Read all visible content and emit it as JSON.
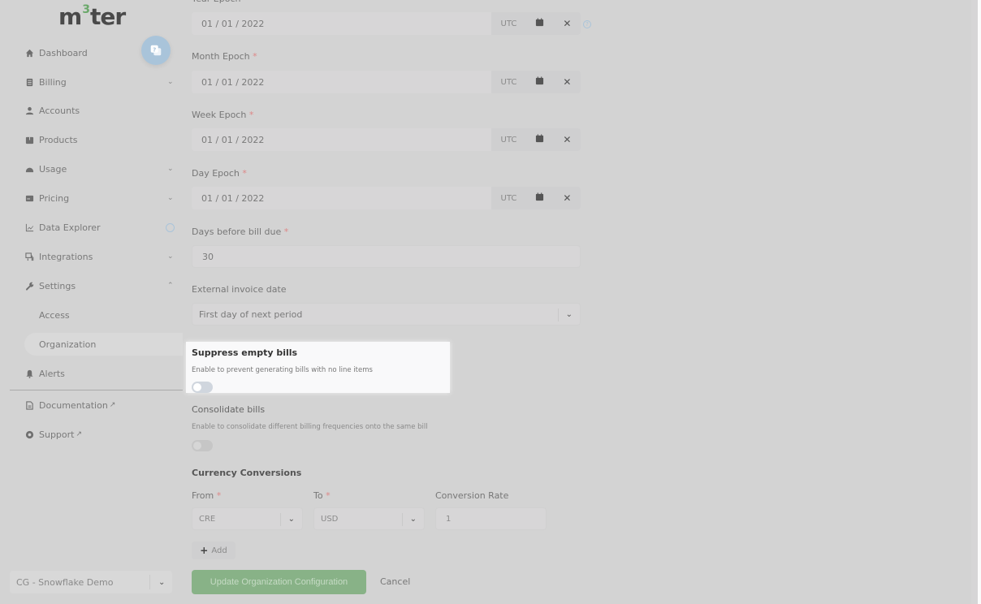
{
  "brand": {
    "logo_pre": "m",
    "logo_sup": "3",
    "logo_post": "ter",
    "accent": "#6aa86a"
  },
  "sidebar": {
    "items": [
      {
        "label": "Dashboard",
        "icon": "home-icon"
      },
      {
        "label": "Billing",
        "icon": "billing-icon",
        "expand": "⌄"
      },
      {
        "label": "Accounts",
        "icon": "user-icon"
      },
      {
        "label": "Products",
        "icon": "box-icon"
      },
      {
        "label": "Usage",
        "icon": "gauge-icon",
        "expand": "⌄"
      },
      {
        "label": "Pricing",
        "icon": "pricing-icon",
        "expand": "⌄"
      },
      {
        "label": "Data Explorer",
        "icon": "chart-icon"
      },
      {
        "label": "Integrations",
        "icon": "integrations-icon",
        "expand": "⌄"
      },
      {
        "label": "Settings",
        "icon": "wrench-icon",
        "expand": "⌃"
      },
      {
        "label": "Alerts",
        "icon": "bell-icon"
      },
      {
        "label": "Documentation",
        "icon": "document-icon"
      },
      {
        "label": "Support",
        "icon": "lifebuoy-icon"
      }
    ],
    "settings_sub": [
      "Access",
      "Organization"
    ],
    "active_sub": "Organization",
    "org_select": "CG - Snowflake Demo",
    "chevron": "⌄"
  },
  "form": {
    "year_epoch": {
      "label": "Year Epoch",
      "value": "01 / 01 / 2022",
      "tz": "UTC"
    },
    "month_epoch": {
      "label": "Month Epoch",
      "value": "01 / 01 / 2022",
      "tz": "UTC"
    },
    "week_epoch": {
      "label": "Week Epoch",
      "value": "01 / 01 / 2022",
      "tz": "UTC"
    },
    "day_epoch": {
      "label": "Day Epoch",
      "value": "01 / 01 / 2022",
      "tz": "UTC"
    },
    "required_mark": "*",
    "days_before_due": {
      "label": "Days before bill due",
      "value": "30"
    },
    "external_invoice_date": {
      "label": "External invoice date",
      "value": "First day of next period"
    },
    "suppress_empty": {
      "label": "Suppress empty bills",
      "description": "Enable to prevent generating bills with no line items",
      "enabled": false
    },
    "consolidate": {
      "label": "Consolidate bills",
      "description": "Enable to consolidate different billing frequencies onto the same bill",
      "enabled": false
    },
    "currency": {
      "title": "Currency Conversions",
      "from_label": "From",
      "to_label": "To",
      "rate_label": "Conversion Rate",
      "from_value": "CRE",
      "to_value": "USD",
      "rate_value": "1",
      "add_label": "Add"
    },
    "submit_label": "Update Organization Configuration",
    "cancel_label": "Cancel"
  },
  "colors": {
    "primary_button": "#88b287",
    "help_bubble": "#a9c4da",
    "required": "#dd8888"
  }
}
